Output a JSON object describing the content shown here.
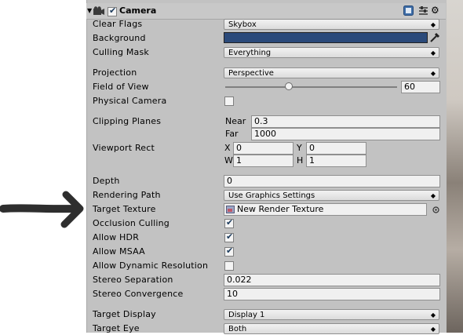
{
  "component": {
    "title": "Camera",
    "enabled": true
  },
  "rows": {
    "clear_flags": {
      "label": "Clear Flags",
      "value": "Skybox"
    },
    "background": {
      "label": "Background",
      "color": "#2b4a7a"
    },
    "culling_mask": {
      "label": "Culling Mask",
      "value": "Everything"
    },
    "projection": {
      "label": "Projection",
      "value": "Perspective"
    },
    "field_of_view": {
      "label": "Field of View",
      "value": "60",
      "slider_fraction": 0.37
    },
    "physical_camera": {
      "label": "Physical Camera",
      "checked": false
    },
    "clipping_planes": {
      "label": "Clipping Planes",
      "near_label": "Near",
      "near": "0.3",
      "far_label": "Far",
      "far": "1000"
    },
    "viewport_rect": {
      "label": "Viewport Rect",
      "x_label": "X",
      "x": "0",
      "y_label": "Y",
      "y": "0",
      "w_label": "W",
      "w": "1",
      "h_label": "H",
      "h": "1"
    },
    "depth": {
      "label": "Depth",
      "value": "0"
    },
    "rendering_path": {
      "label": "Rendering Path",
      "value": "Use Graphics Settings"
    },
    "target_texture": {
      "label": "Target Texture",
      "value": "New Render Texture"
    },
    "occlusion_culling": {
      "label": "Occlusion Culling",
      "checked": true
    },
    "allow_hdr": {
      "label": "Allow HDR",
      "checked": true
    },
    "allow_msaa": {
      "label": "Allow MSAA",
      "checked": true
    },
    "allow_dynamic_resolution": {
      "label": "Allow Dynamic Resolution",
      "checked": false
    },
    "stereo_separation": {
      "label": "Stereo Separation",
      "value": "0.022"
    },
    "stereo_convergence": {
      "label": "Stereo Convergence",
      "value": "10"
    },
    "target_display": {
      "label": "Target Display",
      "value": "Display 1"
    },
    "target_eye": {
      "label": "Target Eye",
      "value": "Both"
    }
  },
  "icons": {
    "camera": "camera-icon",
    "help": "help-icon",
    "preset": "preset-icon",
    "settings": "gear-icon",
    "color_picker": "eyedropper-icon",
    "object_picker": "object-picker-icon",
    "render_texture": "render-texture-icon"
  },
  "colors": {
    "panel": "#c2c2c2",
    "arrow": "#2e2e2e",
    "check": "#1b3a5c"
  }
}
